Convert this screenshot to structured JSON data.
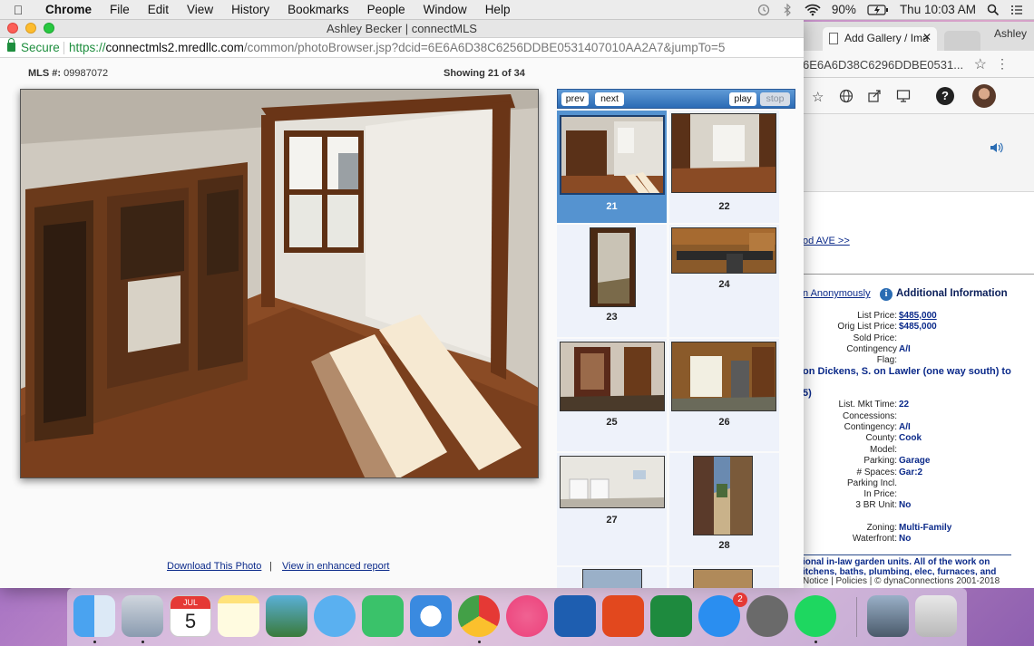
{
  "menubar": {
    "app": "Chrome",
    "items": [
      "File",
      "Edit",
      "View",
      "History",
      "Bookmarks",
      "People",
      "Window",
      "Help"
    ],
    "battery": "90%",
    "clock": "Thu 10:03 AM"
  },
  "back_window": {
    "tab_title": "Add Gallery / Ima",
    "user": "Ashley",
    "url_fragment": "6E6A6D38C6296DDBE0531...",
    "link": "od AVE >>",
    "anon_link": "n Anonymously",
    "info_heading": "Additional Information",
    "fields": [
      {
        "k": "List Price:",
        "v": "$485,000",
        "u": true
      },
      {
        "k": "Orig List Price:",
        "v": "$485,000"
      },
      {
        "k": "Sold Price:",
        "v": ""
      },
      {
        "k": "Contingency",
        "v": "A/I"
      },
      {
        "k": "Flag:",
        "v": ""
      }
    ],
    "directions": "on Dickens, S. on Lawler (one way south) to",
    "directions2": "5)",
    "fields2": [
      {
        "k": "List. Mkt Time:",
        "v": "22"
      },
      {
        "k": "Concessions:",
        "v": ""
      },
      {
        "k": "Contingency:",
        "v": "A/I"
      },
      {
        "k": "County:",
        "v": "Cook"
      },
      {
        "k": "Model:",
        "v": ""
      },
      {
        "k": "Parking:",
        "v": "Garage"
      },
      {
        "k": "# Spaces:",
        "v": "Gar:2"
      },
      {
        "k": "Parking Incl.",
        "v": ""
      },
      {
        "k": "In Price:",
        "v": ""
      },
      {
        "k": "3 BR Unit:",
        "v": "No"
      }
    ],
    "fields3": [
      {
        "k": "Zoning:",
        "v": "Multi-Family"
      },
      {
        "k": "Waterfront:",
        "v": "No"
      }
    ],
    "remarks1": "ional in-law garden units. All of the work on",
    "remarks2": "itchens, baths, plumbing, elec, furnaces, and",
    "footer": "Notice | Policies | © dynaConnections 2001-2018"
  },
  "window": {
    "title": "Ashley Becker | connectMLS",
    "secure_label": "Secure",
    "url_scheme": "https://",
    "url_host": "connectmls2.mredllc.com",
    "url_path": "/common/photoBrowser.jsp?dcid=6E6A6D38C6256DDBE0531407010AA2A7&jumpTo=5"
  },
  "page": {
    "mls_label": "MLS #:",
    "mls_number": "09987072",
    "showing": "Showing 21 of 34",
    "download_link": "Download This Photo",
    "separator": "|",
    "enhanced_link": "View in enhanced report"
  },
  "gallery": {
    "prev": "prev",
    "next": "next",
    "play": "play",
    "stop": "stop",
    "thumbs": [
      "21",
      "22",
      "23",
      "24",
      "25",
      "26",
      "27",
      "28"
    ],
    "selected": "21"
  },
  "dock": {
    "calendar_month": "JUL",
    "calendar_day": "5",
    "appstore_badge": "2"
  }
}
